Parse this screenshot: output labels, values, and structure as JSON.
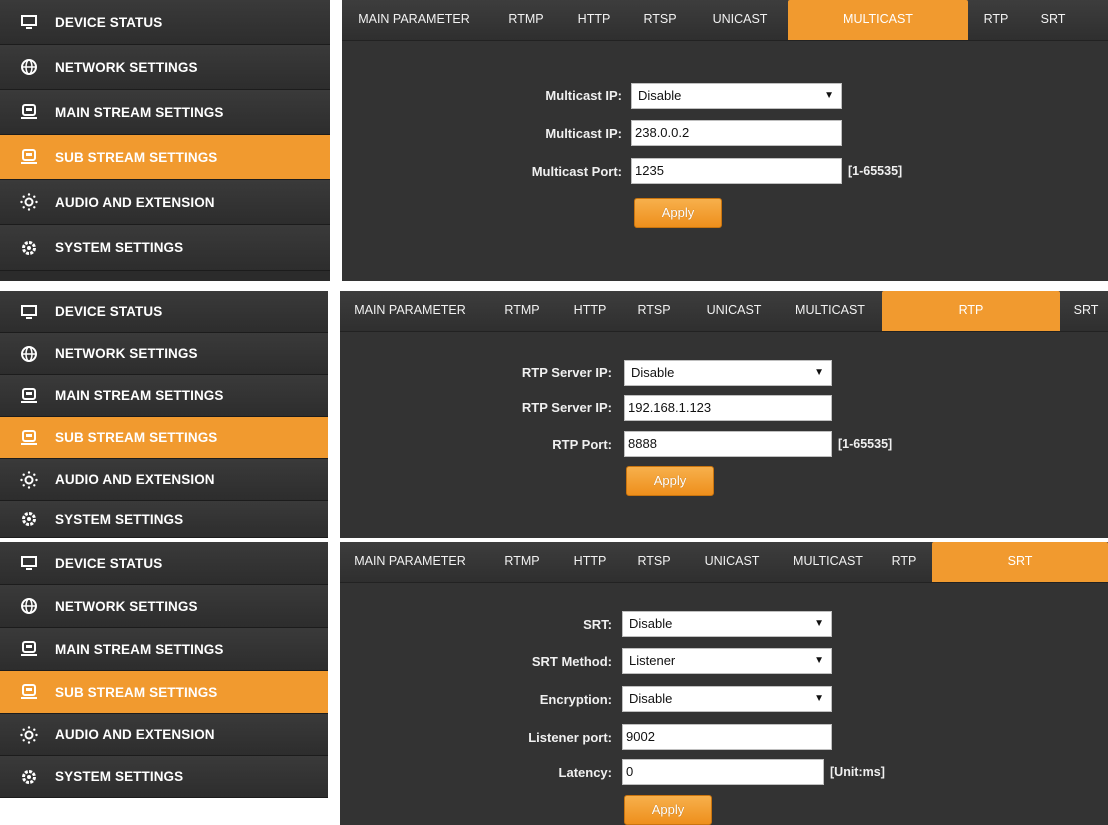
{
  "sidebar": {
    "items": [
      {
        "label": "DEVICE STATUS",
        "icon": "monitor-icon"
      },
      {
        "label": "NETWORK SETTINGS",
        "icon": "globe-icon"
      },
      {
        "label": "MAIN STREAM SETTINGS",
        "icon": "stream-device-icon"
      },
      {
        "label": "SUB STREAM SETTINGS",
        "icon": "stream-device-icon",
        "active": true
      },
      {
        "label": "AUDIO AND EXTENSION",
        "icon": "audio-extension-icon"
      },
      {
        "label": "SYSTEM SETTINGS",
        "icon": "gear-icon"
      }
    ]
  },
  "tabs": [
    "MAIN PARAMETER",
    "RTMP",
    "HTTP",
    "RTSP",
    "UNICAST",
    "MULTICAST",
    "RTP",
    "SRT"
  ],
  "colors": {
    "accent": "#f19a2f",
    "sidebar_bg": "#2d2d2d",
    "content_bg": "#333333"
  },
  "multicast": {
    "active_tab": "MULTICAST",
    "enable_label": "Multicast IP:",
    "enable_value": "Disable",
    "ip_label": "Multicast IP:",
    "ip_value": "238.0.0.2",
    "port_label": "Multicast Port:",
    "port_value": "1235",
    "port_range": "[1-65535]",
    "apply_label": "Apply"
  },
  "rtp": {
    "active_tab": "RTP",
    "enable_label": "RTP Server IP:",
    "enable_value": "Disable",
    "ip_label": "RTP Server IP:",
    "ip_value": "192.168.1.123",
    "port_label": "RTP Port:",
    "port_value": "8888",
    "port_range": "[1-65535]",
    "apply_label": "Apply"
  },
  "srt": {
    "active_tab": "SRT",
    "srt_label": "SRT:",
    "srt_value": "Disable",
    "method_label": "SRT Method:",
    "method_value": "Listener",
    "encryption_label": "Encryption:",
    "encryption_value": "Disable",
    "port_label": "Listener port:",
    "port_value": "9002",
    "latency_label": "Latency:",
    "latency_value": "0",
    "latency_unit": "[Unit:ms]",
    "apply_label": "Apply"
  }
}
